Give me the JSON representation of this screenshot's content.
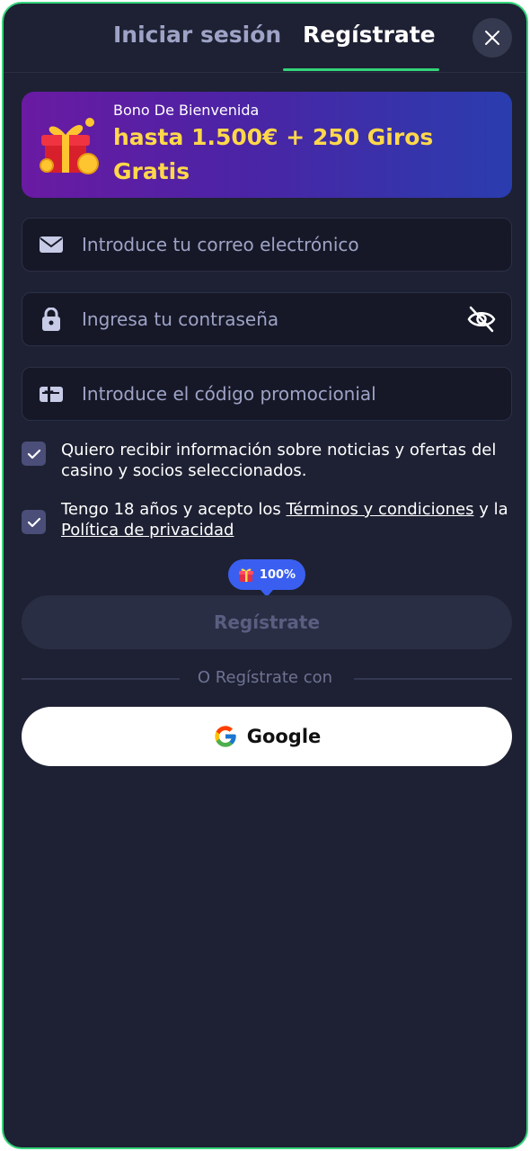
{
  "tabs": {
    "login_label": "Iniciar sesión",
    "register_label": "Regístrate",
    "active": "register"
  },
  "close_icon": "close-icon",
  "banner": {
    "subtitle": "Bono De Bienvenida",
    "title": "hasta 1.500€ + 250 Giros Gratis",
    "icon": "gift-coins-icon"
  },
  "fields": {
    "email": {
      "placeholder": "Introduce tu correo electrónico",
      "value": "",
      "icon": "mail-icon"
    },
    "password": {
      "placeholder": "Ingresa tu contraseña",
      "value": "",
      "icon": "lock-icon",
      "toggle_icon": "eye-off-icon"
    },
    "promo": {
      "placeholder": "Introduce el código promocionial",
      "value": "",
      "icon": "gift-card-icon"
    }
  },
  "consents": {
    "news": {
      "checked": true,
      "text": "Quiero recibir información sobre noticias y ofertas del casino y socios seleccionados."
    },
    "terms": {
      "checked": true,
      "prefix": "Tengo 18 años y acepto los ",
      "terms_link": "Términos y condiciones",
      "middle": " y la ",
      "privacy_link": "Política de privacidad"
    }
  },
  "progress_badge": {
    "label": "100%",
    "percent": 100,
    "icon": "gift-icon"
  },
  "submit_label": "Regístrate",
  "divider_text": "O Regístrate con",
  "google_label": "Google",
  "colors": {
    "background": "#1e2133",
    "accent_border": "#33d47a",
    "banner_text": "#ffd84a",
    "badge_blue": "#3a5ff0",
    "checkbox": "#4a4e78"
  }
}
